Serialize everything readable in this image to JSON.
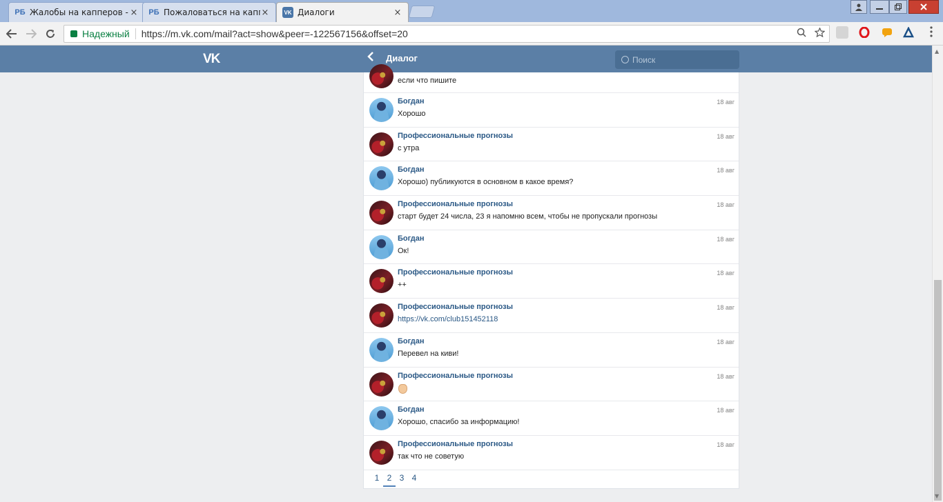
{
  "browser": {
    "tabs": [
      {
        "favicon": "РБ",
        "title": "Жалобы на капперов - "
      },
      {
        "favicon": "РБ",
        "title": "Пожаловаться на капп"
      },
      {
        "favicon": "VK",
        "title": "Диалоги"
      }
    ],
    "tab_close_glyph": "×",
    "security_label": "Надежный",
    "url": "https://m.vk.com/mail?act=show&peer=-122567156&offset=20",
    "colors": {
      "secure": "#0b8043",
      "tab_strip": "#9fb8dd"
    }
  },
  "header": {
    "logo": "VK",
    "back_glyph": "‹",
    "title": "Диалог",
    "search_placeholder": "Поиск",
    "colors": {
      "bar": "#5b7fa6",
      "link": "#2a5885"
    }
  },
  "messages": [
    {
      "author": "",
      "avatar": "prog",
      "date": "",
      "text": "если что пишите",
      "partial": true
    },
    {
      "author": "Богдан",
      "avatar": "bogdan",
      "date": "18 авг",
      "text": "Хорошо"
    },
    {
      "author": "Профессиональные прогнозы",
      "avatar": "prog",
      "date": "18 авг",
      "text": "с утра"
    },
    {
      "author": "Богдан",
      "avatar": "bogdan",
      "date": "18 авг",
      "text": "Хорошо) публикуются в основном в какое время?"
    },
    {
      "author": "Профессиональные прогнозы",
      "avatar": "prog",
      "date": "18 авг",
      "text": "старт будет 24 числа, 23 я напомню всем, чтобы не пропускали прогнозы"
    },
    {
      "author": "Богдан",
      "avatar": "bogdan",
      "date": "18 авг",
      "text": "Ок!"
    },
    {
      "author": "Профессиональные прогнозы",
      "avatar": "prog",
      "date": "18 авг",
      "text": "++"
    },
    {
      "author": "Профессиональные прогнозы",
      "avatar": "prog",
      "date": "18 авг",
      "text": "https://vk.com/club151452118",
      "link": true
    },
    {
      "author": "Богдан",
      "avatar": "bogdan",
      "date": "18 авг",
      "text": "Перевел на киви!"
    },
    {
      "author": "Профессиональные прогнозы",
      "avatar": "prog",
      "date": "18 авг",
      "text": "",
      "emoji": "ok-hand-emoji"
    },
    {
      "author": "Богдан",
      "avatar": "bogdan",
      "date": "18 авг",
      "text": "Хорошо, спасибо за информацию!"
    },
    {
      "author": "Профессиональные прогнозы",
      "avatar": "prog",
      "date": "18 авг",
      "text": "так что не советую"
    }
  ],
  "pagination": {
    "pages": [
      "1",
      "2",
      "3",
      "4"
    ],
    "current": "2"
  }
}
